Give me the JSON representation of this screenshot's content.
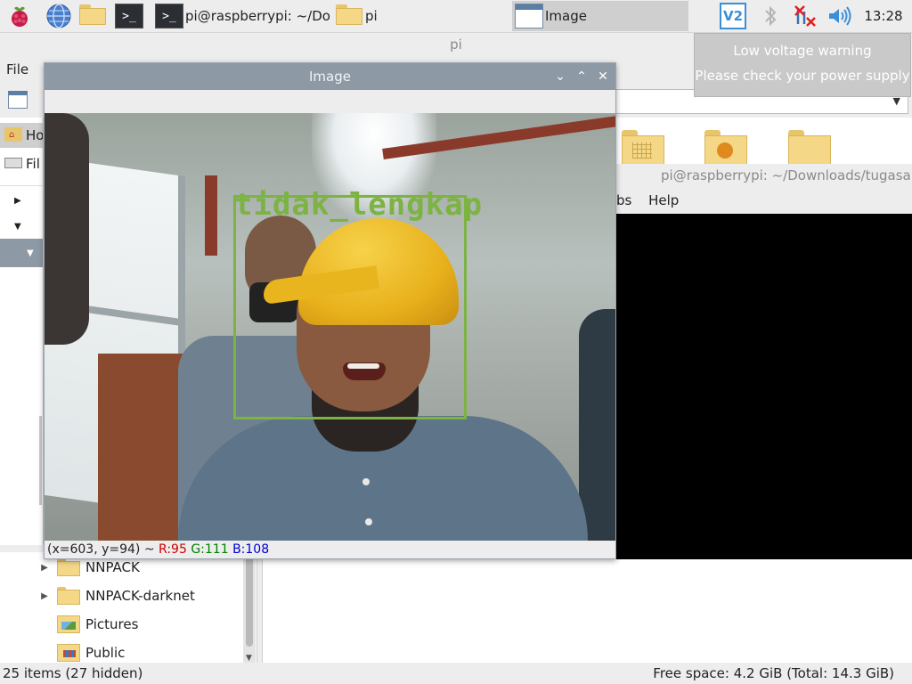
{
  "taskbar": {
    "tasks": [
      {
        "label": "pi@raspberrypi: ~/Do..."
      },
      {
        "label": "pi"
      },
      {
        "label": "Image"
      }
    ],
    "clock": "13:28",
    "terminal_glyph": ">_",
    "vnc_text": "V2"
  },
  "file_manager": {
    "title": "pi",
    "menu_file": "File",
    "side_items": [
      "Ho",
      "Fil"
    ],
    "tree_items": [
      "NNPACK",
      "NNPACK-darknet",
      "Pictures",
      "Public"
    ],
    "status_left": "25 items (27 hidden)",
    "status_right": "Free space: 4.2 GiB (Total: 14.3 GiB)"
  },
  "terminal": {
    "title": "pi@raspberrypi: ~/Downloads/tugasakh",
    "menu_partial": "bs",
    "menu_help": "Help"
  },
  "image_window": {
    "title": "Image",
    "detection_label": "tidak_lengkap",
    "status_coords": "(x=603, y=94) ~",
    "status_r": "R:95",
    "status_g": "G:111",
    "status_b": "B:108"
  },
  "notification": {
    "line1": "Low voltage warning",
    "line2": "Please check your power supply"
  },
  "icons": [
    "raspberry-menu-icon",
    "web-browser-icon",
    "file-manager-icon",
    "terminal-icon",
    "vnc-icon",
    "bluetooth-icon",
    "network-disconnected-icon",
    "volume-icon"
  ],
  "colors": {
    "detection": "#7cb342",
    "titlebar": "#8e99a6",
    "panel": "#ededed"
  }
}
